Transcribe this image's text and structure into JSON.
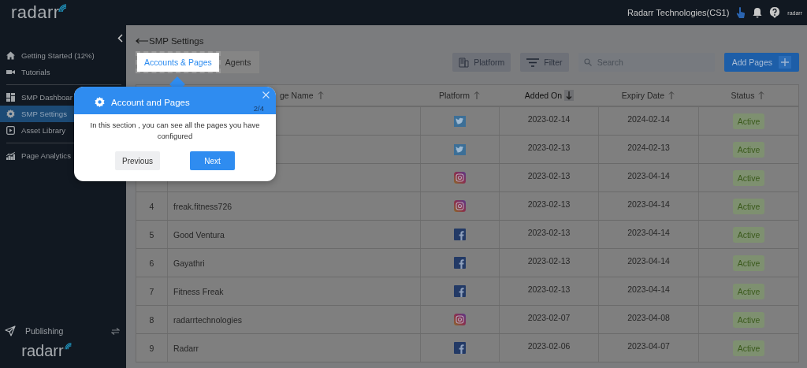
{
  "header": {
    "logo": "radarr",
    "company": "Radarr Technologies(CS1)",
    "mini_logo": "radarr"
  },
  "sidebar": {
    "sections": [
      {
        "items": [
          {
            "label": "Getting Started (12%)",
            "selected": false
          },
          {
            "label": "Tutorials",
            "selected": false
          }
        ]
      },
      {
        "items": [
          {
            "label": "SMP Dashboar",
            "selected": false
          },
          {
            "label": "SMP Settings",
            "selected": true
          },
          {
            "label": "Asset Library",
            "selected": false
          }
        ]
      },
      {
        "items": [
          {
            "label": "Page Analytics",
            "selected": false
          }
        ]
      }
    ],
    "footer": {
      "label": "Publishing",
      "logo": "radarr"
    }
  },
  "page": {
    "title": "SMP Settings",
    "tabs": [
      {
        "label": "Accounts & Pages",
        "selected": true
      },
      {
        "label": "Agents",
        "selected": false
      }
    ],
    "toolbar": {
      "platform": "Platform",
      "filter": "Filter",
      "search": {
        "placeholder": "Search"
      },
      "add": "Add Pages"
    }
  },
  "table": {
    "columns": [
      {
        "label": "ge Name",
        "descending": false,
        "active": false
      },
      {
        "label": "Platform",
        "descending": false,
        "active": false
      },
      {
        "label": "Added On",
        "descending": true,
        "active": true
      },
      {
        "label": "Expiry Date",
        "descending": false,
        "active": false
      },
      {
        "label": "Status",
        "descending": false,
        "active": false
      }
    ],
    "rows": [
      {
        "kind": "twitter",
        "added": "2023-02-14",
        "expiry": "2024-02-14",
        "status": "Active"
      },
      {
        "kind": "twitter",
        "added": "2023-02-13",
        "expiry": "2024-02-13",
        "status": "Active"
      },
      {
        "kind": "instagram",
        "added": "2023-02-13",
        "expiry": "2023-04-14",
        "status": "Active"
      },
      {
        "number": "4",
        "name": "freak.fitness726",
        "kind": "instagram",
        "added": "2023-02-13",
        "expiry": "2023-04-14",
        "status": "Active"
      },
      {
        "number": "5",
        "name": "Good Ventura",
        "kind": "facebook",
        "added": "2023-02-13",
        "expiry": "2023-04-14",
        "status": "Active"
      },
      {
        "number": "6",
        "name": "Gayathri",
        "kind": "facebook",
        "added": "2023-02-13",
        "expiry": "2023-04-14",
        "status": "Active"
      },
      {
        "number": "7",
        "name": "Fitness Freak",
        "kind": "facebook",
        "added": "2023-02-13",
        "expiry": "2023-04-14",
        "status": "Active"
      },
      {
        "number": "8",
        "name": "radarrtechnologies",
        "kind": "instagram",
        "added": "2023-02-07",
        "expiry": "2023-04-08",
        "status": "Active"
      },
      {
        "number": "9",
        "name": "Radarr",
        "kind": "facebook",
        "added": "2023-02-06",
        "expiry": "2023-04-07",
        "status": "Active"
      }
    ]
  },
  "tour": {
    "title": "Account and Pages",
    "step": "2/4",
    "body": "In this section , you can see all the pages you have configured",
    "previous": "Previous",
    "next": "Next"
  }
}
